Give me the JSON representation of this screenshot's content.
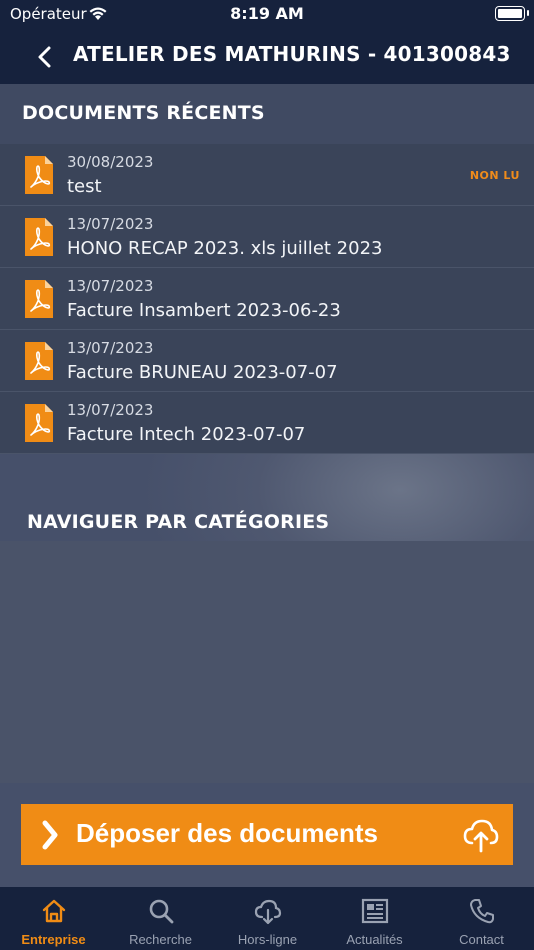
{
  "status_bar": {
    "carrier": "Opérateur",
    "time": "8:19 AM"
  },
  "nav": {
    "title": "ATELIER DES MATHURINS - 401300843"
  },
  "recent": {
    "header": "DOCUMENTS RÉCENTS",
    "documents": [
      {
        "date": "30/08/2023",
        "name": "test",
        "badge": "NON LU"
      },
      {
        "date": "13/07/2023",
        "name": "HONO RECAP 2023. xls juillet 2023",
        "badge": ""
      },
      {
        "date": "13/07/2023",
        "name": "Facture Insambert 2023-06-23",
        "badge": ""
      },
      {
        "date": "13/07/2023",
        "name": "Facture BRUNEAU 2023-07-07",
        "badge": ""
      },
      {
        "date": "13/07/2023",
        "name": "Facture Intech 2023-07-07",
        "badge": ""
      }
    ]
  },
  "categories": {
    "header": "NAVIGUER PAR CATÉGORIES"
  },
  "upload": {
    "label": "Déposer des documents"
  },
  "tabs": [
    {
      "label": "Entreprise",
      "icon": "home-icon",
      "active": true
    },
    {
      "label": "Recherche",
      "icon": "search-icon",
      "active": false
    },
    {
      "label": "Hors-ligne",
      "icon": "cloud-download-icon",
      "active": false
    },
    {
      "label": "Actualités",
      "icon": "news-icon",
      "active": false
    },
    {
      "label": "Contact",
      "icon": "phone-icon",
      "active": false
    }
  ],
  "colors": {
    "accent": "#f08c15",
    "navy": "#16223d",
    "row": "#3a4459"
  }
}
